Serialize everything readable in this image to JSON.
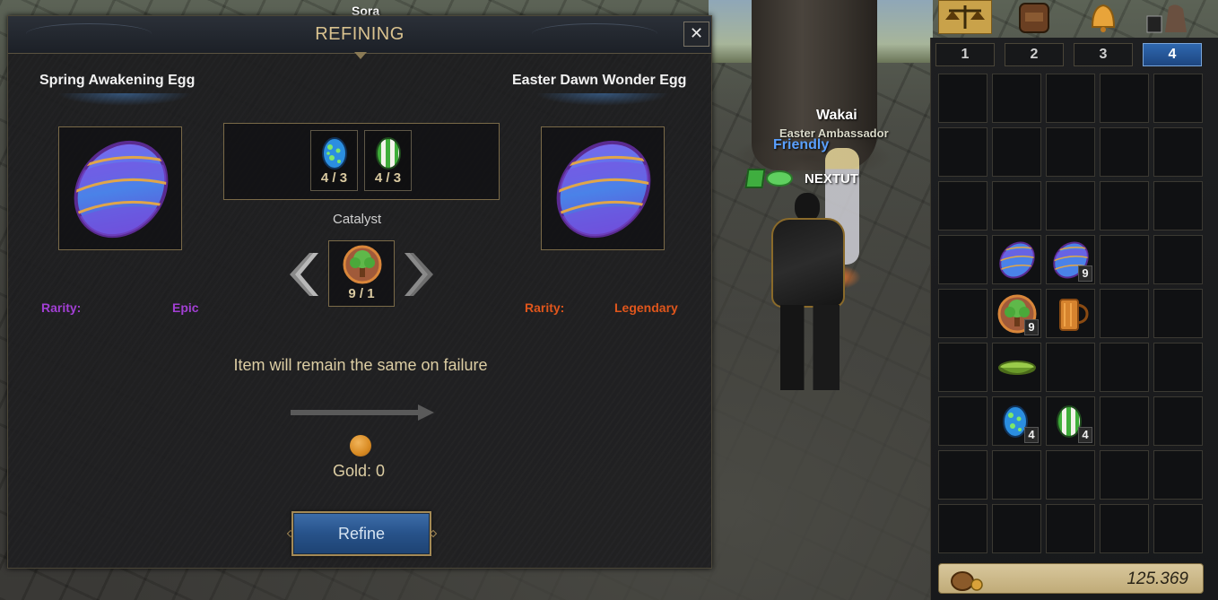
{
  "scene": {
    "player_label": "Sora",
    "npc": {
      "name": "Wakai",
      "title": "Easter Ambassador",
      "status": "Friendly",
      "guild_member": "NEXTUT"
    }
  },
  "refining": {
    "title": "REFINING",
    "close_label": "✕",
    "source": {
      "name": "Spring Awakening Egg",
      "rarity_label": "Rarity:",
      "rarity_value": "Epic"
    },
    "result": {
      "name": "Easter Dawn Wonder Egg",
      "rarity_label": "Rarity:",
      "rarity_value": "Legendary"
    },
    "materials": [
      {
        "icon": "blue-spotted-egg-icon",
        "count": "4 / 3"
      },
      {
        "icon": "green-striped-egg-icon",
        "count": "4 / 3"
      }
    ],
    "catalyst": {
      "label": "Catalyst",
      "icon": "tree-token-icon",
      "count": "9 / 1"
    },
    "failure_text": "Item will remain the same on failure",
    "gold_text": "Gold: 0",
    "refine_label": "Refine",
    "colors": {
      "epic": "#a23fd4",
      "legendary": "#e0561c",
      "title": "#d9c28f"
    }
  },
  "inventory": {
    "top_icons": [
      "scales-icon",
      "backpack-icon",
      "bell-icon",
      "mount-icon"
    ],
    "tabs": [
      "1",
      "2",
      "3",
      "4"
    ],
    "active_tab": "4",
    "slots": {
      "r3c1": {
        "icon": "purple-egg-icon",
        "count": ""
      },
      "r3c2": {
        "icon": "purple-egg-icon",
        "count": "9"
      },
      "r4c1": {
        "icon": "tree-token-icon",
        "count": "9"
      },
      "r4c2": {
        "icon": "wooden-mug-icon",
        "count": ""
      },
      "r5c1": {
        "icon": "green-bowl-icon",
        "count": ""
      },
      "r6c1": {
        "icon": "blue-spotted-egg-icon",
        "count": "4"
      },
      "r6c2": {
        "icon": "green-striped-egg-icon",
        "count": "4"
      }
    },
    "gold_amount": "125.369"
  }
}
